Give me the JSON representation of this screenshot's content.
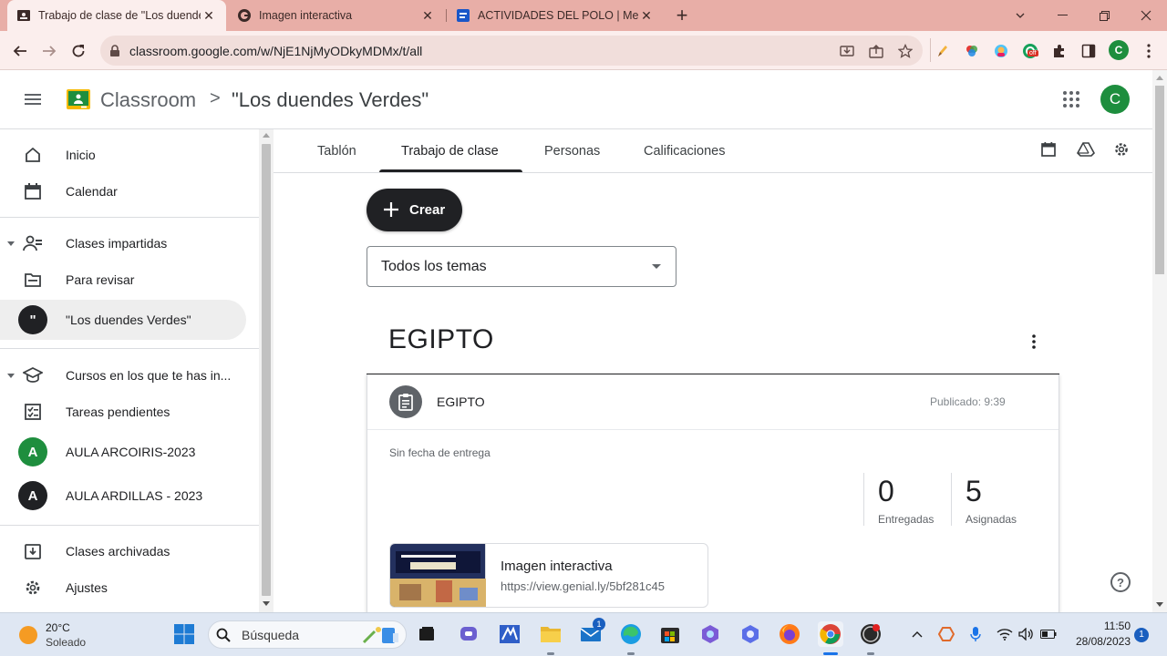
{
  "browser": {
    "tabs": [
      {
        "title": "Trabajo de clase de \"Los duendes Verdes\"",
        "active": true
      },
      {
        "title": "Imagen interactiva",
        "active": false
      },
      {
        "title": "ACTIVIDADES DEL POLO | Mediateca",
        "active": false
      }
    ],
    "new_tab_symbol": "+",
    "url": "classroom.google.com/w/NjE1NjMyODkyMDMx/t/all",
    "extension_badge": "off",
    "profile_initial": "C"
  },
  "app": {
    "name": "Classroom",
    "breadcrumb_separator": ">",
    "class_name": "\"Los duendes Verdes\"",
    "profile_initial": "C"
  },
  "sidebar": {
    "items": [
      {
        "label": "Inicio",
        "icon": "home-icon"
      },
      {
        "label": "Calendar",
        "icon": "calendar-icon"
      },
      {
        "label": "Clases impartidas",
        "icon": "teacher-icon"
      },
      {
        "label": "Para revisar",
        "icon": "review-folder-icon"
      },
      {
        "label": "\"Los duendes Verdes\"",
        "avatar": "\"",
        "selected": true
      },
      {
        "label": "Cursos en los que te has in...",
        "icon": "school-cap-icon"
      },
      {
        "label": "Tareas pendientes",
        "icon": "todo-checklist-icon"
      },
      {
        "label": "AULA ARCOIRIS-2023",
        "avatar": "A",
        "avatar_color": "#1e8e3e"
      },
      {
        "label": "AULA ARDILLAS - 2023",
        "avatar": "A",
        "avatar_color": "#202124"
      },
      {
        "label": "Clases archivadas",
        "icon": "archive-icon"
      },
      {
        "label": "Ajustes",
        "icon": "gear-icon"
      }
    ]
  },
  "nav_tabs": [
    "Tablón",
    "Trabajo de clase",
    "Personas",
    "Calificaciones"
  ],
  "active_tab": "Trabajo de clase",
  "create_button": "Crear",
  "topic_filter": {
    "selected": "Todos los temas"
  },
  "topic": {
    "title": "EGIPTO",
    "assignment": {
      "title": "EGIPTO",
      "published": "Publicado: 9:39",
      "due": "Sin fecha de entrega",
      "stats": [
        {
          "value": "0",
          "label": "Entregadas"
        },
        {
          "value": "5",
          "label": "Asignadas"
        }
      ],
      "attachment": {
        "title": "Imagen interactiva",
        "url": "https://view.genial.ly/5bf281c45"
      }
    }
  },
  "taskbar": {
    "weather_temp": "20°C",
    "weather_desc": "Soleado",
    "search_placeholder": "Búsqueda",
    "time": "11:50",
    "date": "28/08/2023",
    "notification_count": "1",
    "mail_badge": "1"
  },
  "colors": {
    "tabstrip": "#e8aea7",
    "toolbar": "#fbeeed",
    "classroom_green": "#1e8e3e",
    "taskbar": "#dfe7f3"
  }
}
